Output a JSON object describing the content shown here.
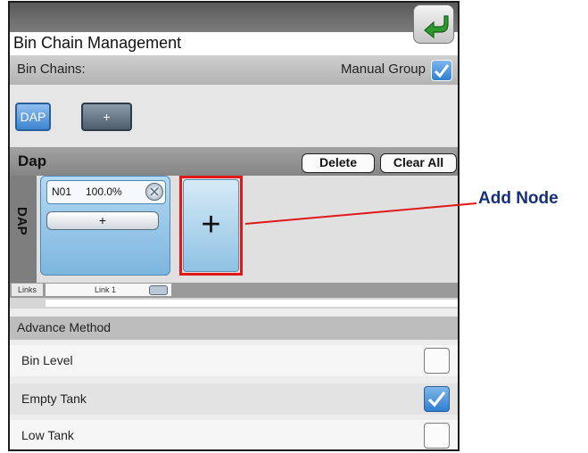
{
  "window": {
    "title": "Bin Chain Management"
  },
  "chains": {
    "label": "Bin Chains:",
    "manual_group_label": "Manual Group",
    "manual_group_checked": true
  },
  "chain_buttons": {
    "dap": "DAP",
    "add": "+"
  },
  "chain_detail": {
    "name": "Dap",
    "vertical_label": "DAP",
    "delete": "Delete",
    "clear_all": "Clear All",
    "node": {
      "id": "N01",
      "percent": "100.0%",
      "add_bin": "+"
    },
    "add_node_button": "+"
  },
  "links": {
    "label": "Links",
    "link_name": "Link 1"
  },
  "advance_method": {
    "header": "Advance Method",
    "options": [
      {
        "label": "Bin Level",
        "checked": false
      },
      {
        "label": "Empty Tank",
        "checked": true
      },
      {
        "label": "Low Tank",
        "checked": false
      }
    ]
  },
  "callout": {
    "label": "Add Node"
  },
  "colors": {
    "accent_blue": "#2e7fd0",
    "highlight_red": "#e01818",
    "callout_text": "#17307a"
  }
}
